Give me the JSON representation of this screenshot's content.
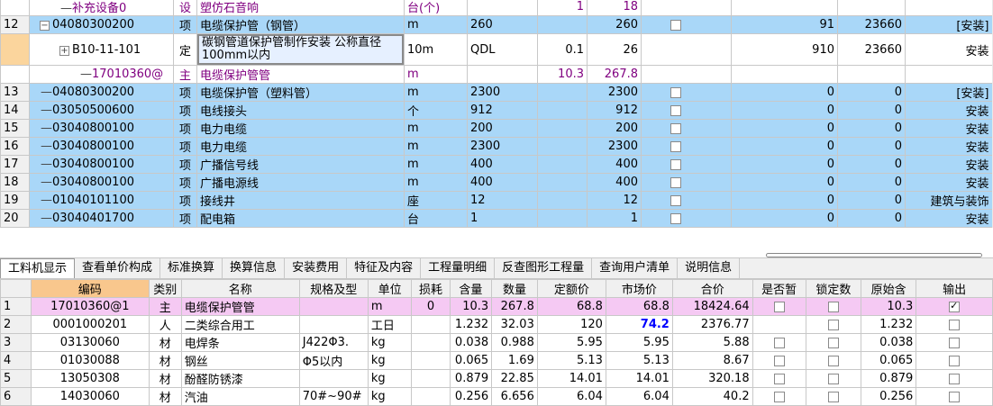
{
  "top_rows": [
    {
      "rn": "",
      "code": "补充设备0",
      "type": "设",
      "name": "塑仿石音响",
      "unit": "台(个)",
      "qty": "",
      "qty2": "1",
      "val": "18",
      "chk": "",
      "c1": "",
      "c2": "",
      "c3": "",
      "style": "white",
      "purple": true,
      "indent": 2
    },
    {
      "rn": "12",
      "code": "04080300200",
      "type": "项",
      "name": "电缆保护管（钢管）",
      "unit": "m",
      "qty": "260",
      "qty2": "",
      "val": "260",
      "chk": "box",
      "c1": "91",
      "c2": "23660",
      "c3": "[安装]",
      "style": "blue",
      "purple": false,
      "indent": 1,
      "expander": "−"
    },
    {
      "rn": "",
      "code": "B10-11-101",
      "type": "定",
      "name": "碳钢管道保护管制作安装 公称直径100mm以内",
      "unit": "10m",
      "qty": "QDL",
      "qty2": "0.1",
      "val": "26",
      "chk": "",
      "c1": "910",
      "c2": "23660",
      "c3": "安装",
      "style": "white",
      "purple": false,
      "indent": 2,
      "expander": "+",
      "tall": true,
      "edit": true
    },
    {
      "rn": "",
      "code": "17010360@",
      "type": "主",
      "name": "电缆保护管管",
      "unit": "m",
      "qty": "",
      "qty2": "10.3",
      "val": "267.8",
      "chk": "",
      "c1": "",
      "c2": "",
      "c3": "",
      "style": "white",
      "purple": true,
      "indent": 3
    },
    {
      "rn": "13",
      "code": "04080300200",
      "type": "项",
      "name": "电缆保护管（塑料管）",
      "unit": "m",
      "qty": "2300",
      "qty2": "",
      "val": "2300",
      "chk": "box",
      "c1": "0",
      "c2": "0",
      "c3": "[安装]",
      "style": "blue",
      "purple": false,
      "indent": 1
    },
    {
      "rn": "14",
      "code": "03050500600",
      "type": "项",
      "name": "电线接头",
      "unit": "个",
      "qty": "912",
      "qty2": "",
      "val": "912",
      "chk": "box",
      "c1": "0",
      "c2": "0",
      "c3": "安装",
      "style": "blue",
      "purple": false,
      "indent": 1
    },
    {
      "rn": "15",
      "code": "03040800100",
      "type": "项",
      "name": "电力电缆",
      "unit": "m",
      "qty": "200",
      "qty2": "",
      "val": "200",
      "chk": "box",
      "c1": "0",
      "c2": "0",
      "c3": "安装",
      "style": "blue",
      "purple": false,
      "indent": 1
    },
    {
      "rn": "16",
      "code": "03040800100",
      "type": "项",
      "name": "电力电缆",
      "unit": "m",
      "qty": "2300",
      "qty2": "",
      "val": "2300",
      "chk": "box",
      "c1": "0",
      "c2": "0",
      "c3": "安装",
      "style": "blue",
      "purple": false,
      "indent": 1
    },
    {
      "rn": "17",
      "code": "03040800100",
      "type": "项",
      "name": "广播信号线",
      "unit": "m",
      "qty": "400",
      "qty2": "",
      "val": "400",
      "chk": "box",
      "c1": "0",
      "c2": "0",
      "c3": "安装",
      "style": "blue",
      "purple": false,
      "indent": 1
    },
    {
      "rn": "18",
      "code": "03040800100",
      "type": "项",
      "name": "广播电源线",
      "unit": "m",
      "qty": "400",
      "qty2": "",
      "val": "400",
      "chk": "box",
      "c1": "0",
      "c2": "0",
      "c3": "安装",
      "style": "blue",
      "purple": false,
      "indent": 1
    },
    {
      "rn": "19",
      "code": "01040101100",
      "type": "项",
      "name": "接线井",
      "unit": "座",
      "qty": "12",
      "qty2": "",
      "val": "12",
      "chk": "box",
      "c1": "0",
      "c2": "0",
      "c3": "建筑与装饰",
      "style": "blue",
      "purple": false,
      "indent": 1
    },
    {
      "rn": "20",
      "code": "03040401700",
      "type": "项",
      "name": "配电箱",
      "unit": "台",
      "qty": "1",
      "qty2": "",
      "val": "1",
      "chk": "box",
      "c1": "0",
      "c2": "0",
      "c3": "安装",
      "style": "blue",
      "purple": false,
      "indent": 1
    }
  ],
  "tabs": [
    "工料机显示",
    "查看单价构成",
    "标准换算",
    "换算信息",
    "安装费用",
    "特征及内容",
    "工程量明细",
    "反查图形工程量",
    "查询用户清单",
    "说明信息"
  ],
  "bottom_headers": [
    "",
    "编码",
    "类别",
    "名称",
    "规格及型",
    "单位",
    "损耗",
    "含量",
    "数量",
    "定额价",
    "市场价",
    "合价",
    "是否暂",
    "锁定数",
    "原始含",
    "输出"
  ],
  "bottom_rows": [
    {
      "rn": "1",
      "code": "17010360@1",
      "type": "主",
      "name": "电缆保护管管",
      "spec": "",
      "unit": "m",
      "loss": "0",
      "content": "10.3",
      "qty": "267.8",
      "base": "68.8",
      "market": "68.8",
      "total": "18424.64",
      "tmp": "box",
      "lock": "box",
      "orig": "10.3",
      "out": "checked",
      "pink": true,
      "bold_market": false
    },
    {
      "rn": "2",
      "code": "0001000201",
      "type": "人",
      "name": "二类综合用工",
      "spec": "",
      "unit": "工日",
      "loss": "",
      "content": "1.232",
      "qty": "32.03",
      "base": "120",
      "market": "74.2",
      "total": "2376.77",
      "tmp": "",
      "lock": "box",
      "orig": "1.232",
      "out": "box",
      "pink": false,
      "bold_market": true
    },
    {
      "rn": "3",
      "code": "03130060",
      "type": "材",
      "name": "电焊条",
      "spec": "J422Φ3.",
      "unit": "kg",
      "loss": "",
      "content": "0.038",
      "qty": "0.988",
      "base": "5.95",
      "market": "5.95",
      "total": "5.88",
      "tmp": "box",
      "lock": "box",
      "orig": "0.038",
      "out": "box",
      "pink": false,
      "bold_market": false
    },
    {
      "rn": "4",
      "code": "01030088",
      "type": "材",
      "name": "钢丝",
      "spec": "Φ5以内",
      "unit": "kg",
      "loss": "",
      "content": "0.065",
      "qty": "1.69",
      "base": "5.13",
      "market": "5.13",
      "total": "8.67",
      "tmp": "box",
      "lock": "box",
      "orig": "0.065",
      "out": "box",
      "pink": false,
      "bold_market": false
    },
    {
      "rn": "5",
      "code": "13050308",
      "type": "材",
      "name": "酚醛防锈漆",
      "spec": "",
      "unit": "kg",
      "loss": "",
      "content": "0.879",
      "qty": "22.85",
      "base": "14.01",
      "market": "14.01",
      "total": "320.18",
      "tmp": "box",
      "lock": "box",
      "orig": "0.879",
      "out": "box",
      "pink": false,
      "bold_market": false
    },
    {
      "rn": "6",
      "code": "14030060",
      "type": "材",
      "name": "汽油",
      "spec": "70#~90#",
      "unit": "kg",
      "loss": "",
      "content": "0.256",
      "qty": "6.656",
      "base": "6.04",
      "market": "6.04",
      "total": "40.2",
      "tmp": "box",
      "lock": "box",
      "orig": "0.256",
      "out": "box",
      "pink": false,
      "bold_market": false
    }
  ]
}
